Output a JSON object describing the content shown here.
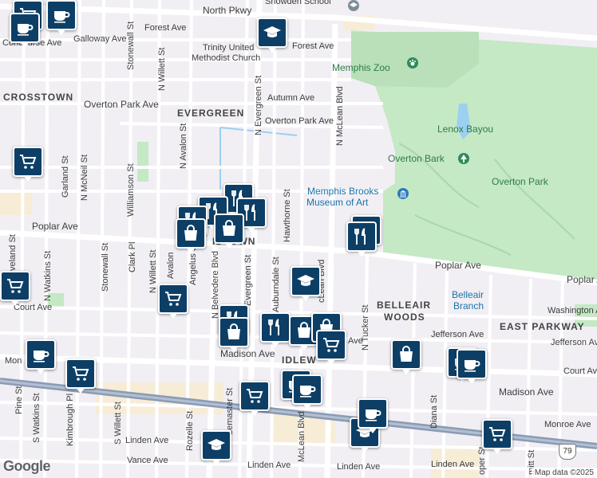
{
  "map": {
    "attribution": "Map data ©2025",
    "logo": "Google",
    "highway_shield": "79"
  },
  "roads": {
    "north_pkwy": "North Pkwy",
    "forest_ave_w": "Forest Ave",
    "forest_ave_e": "Forest Ave",
    "galloway_ave": "Galloway Ave",
    "concourse_ave": "Concourse Ave",
    "overton_park_ave_w": "Overton Park Ave",
    "overton_park_ave_e": "Overton Park Ave",
    "autumn_ave": "Autumn Ave",
    "poplar_ave_w": "Poplar Ave",
    "poplar_ave_e": "Poplar Ave",
    "poplar_ave_far": "Poplar A",
    "court_ave_w": "Court Ave",
    "court_ave_e": "Court Ave",
    "madison_ave_w": "Madison Ave",
    "madison_ave_e": "Madison Ave",
    "monroe_ave_w": "Mon",
    "monroe_ave_e": "Monroe Ave",
    "linden_ave_w": "Linden Ave",
    "linden_ave_c": "Linden Ave",
    "linden_ave_e": "Linden Ave",
    "linden_ave_far": "Linden Ave",
    "vance_ave": "Vance Ave",
    "jefferson_ave": "Jefferson Ave",
    "jefferson_ave_e": "Jefferson Ave",
    "washington_ave": "Washington A",
    "n_evergreen_st": "N Evergreen St",
    "n_mclean_blvd": "N McLean Blvd",
    "n_avalon_st": "N Avalon St",
    "stonewall_st_n": "Stonewall St",
    "stonewall_st_s": "Stonewall St",
    "n_willett_st_n": "N Willett St",
    "n_willett_st_s": "N Willett St",
    "garland_st": "Garland St",
    "n_mcneil_st": "N McNeil St",
    "williamson_st": "Williamson St",
    "clark_pl": "Clark Pl",
    "avalon": "Avalon",
    "angelus_st": "Angelus St",
    "n_belvedere_blvd": "N Belvedere Blvd",
    "evergreen_st": "Evergreen St",
    "auburndale_st": "Auburndale St",
    "hawthorne_st": "Hawthorne St",
    "mclean_blvd_mid": "cLean Blvd",
    "mclean_blvd_s": "McLean Blvd",
    "n_tucker_st": "N Tucker St",
    "n_watkins_st": "N Watkins St",
    "s_watkins_st": "S Watkins St",
    "pine_st": "Pine St",
    "kimbrough_pl": "Kimbrough Pl",
    "s_willett_st": "S Willett St",
    "rozelle_st": "Rozelle St",
    "lemaster_st": "Lemaster St",
    "diana_st": "Diana St",
    "cooper_st": "oper St",
    "rembert_st": "mitt St",
    "veland_st": "veland St",
    "ave_short": "Ave"
  },
  "neighborhoods": {
    "crosstown": "CROSSTOWN",
    "evergreen": "EVERGREEN",
    "midtown": "IDTOWN",
    "belleair_woods_1": "BELLEAIR",
    "belleair_woods_2": "WOODS",
    "east_parkway": "EAST PARKWAY",
    "idlewild": "IDLEW"
  },
  "places": {
    "snowden_school": "Snowden School",
    "trinity_1": "Trinity United",
    "trinity_2": "Methodist Church",
    "memphis_zoo": "Memphis Zoo",
    "lenox_bayou": "Lenox Bayou",
    "overton_bark": "Overton Bark",
    "overton_park": "Overton Park",
    "brooks_1": "Memphis Brooks",
    "brooks_2": "Museum of Art",
    "belleair_1": "Belleair",
    "belleair_2": "Branch"
  },
  "markers": [
    {
      "icon": "shopping-cart-icon"
    },
    {
      "icon": "coffee-cup-icon"
    },
    {
      "icon": "coffee-cup-icon"
    },
    {
      "icon": "graduation-cap-icon"
    },
    {
      "icon": "shopping-cart-icon"
    },
    {
      "icon": "restaurant-icon"
    },
    {
      "icon": "restaurant-icon"
    },
    {
      "icon": "restaurant-icon"
    },
    {
      "icon": "restaurant-icon"
    },
    {
      "icon": "shopping-bag-icon"
    },
    {
      "icon": "shopping-bag-icon"
    },
    {
      "icon": "restaurant-icon"
    },
    {
      "icon": "restaurant-icon"
    },
    {
      "icon": "shopping-cart-icon"
    },
    {
      "icon": "shopping-cart-icon"
    },
    {
      "icon": "graduation-cap-icon"
    },
    {
      "icon": "restaurant-icon"
    },
    {
      "icon": "shopping-bag-icon"
    },
    {
      "icon": "restaurant-icon"
    },
    {
      "icon": "shopping-bag-icon"
    },
    {
      "icon": "shopping-bag-icon"
    },
    {
      "icon": "shopping-cart-icon"
    },
    {
      "icon": "coffee-cup-icon"
    },
    {
      "icon": "shopping-cart-icon"
    },
    {
      "icon": "shopping-bag-icon"
    },
    {
      "icon": "coffee-cup-icon"
    },
    {
      "icon": "coffee-cup-icon"
    },
    {
      "icon": "shopping-cart-icon"
    },
    {
      "icon": "coffee-cup-icon"
    },
    {
      "icon": "coffee-cup-icon"
    },
    {
      "icon": "graduation-cap-icon"
    },
    {
      "icon": "shopping-cart-icon"
    },
    {
      "icon": "graduation-cap-icon"
    },
    {
      "icon": "coffee-cup-icon"
    }
  ],
  "colors": {
    "park": "#c5e8c5",
    "road": "#ffffff",
    "highway": "#8a9bb4",
    "marker": "#0d3f66",
    "commercial": "#f7ecd6",
    "water": "#9cd0f0"
  }
}
